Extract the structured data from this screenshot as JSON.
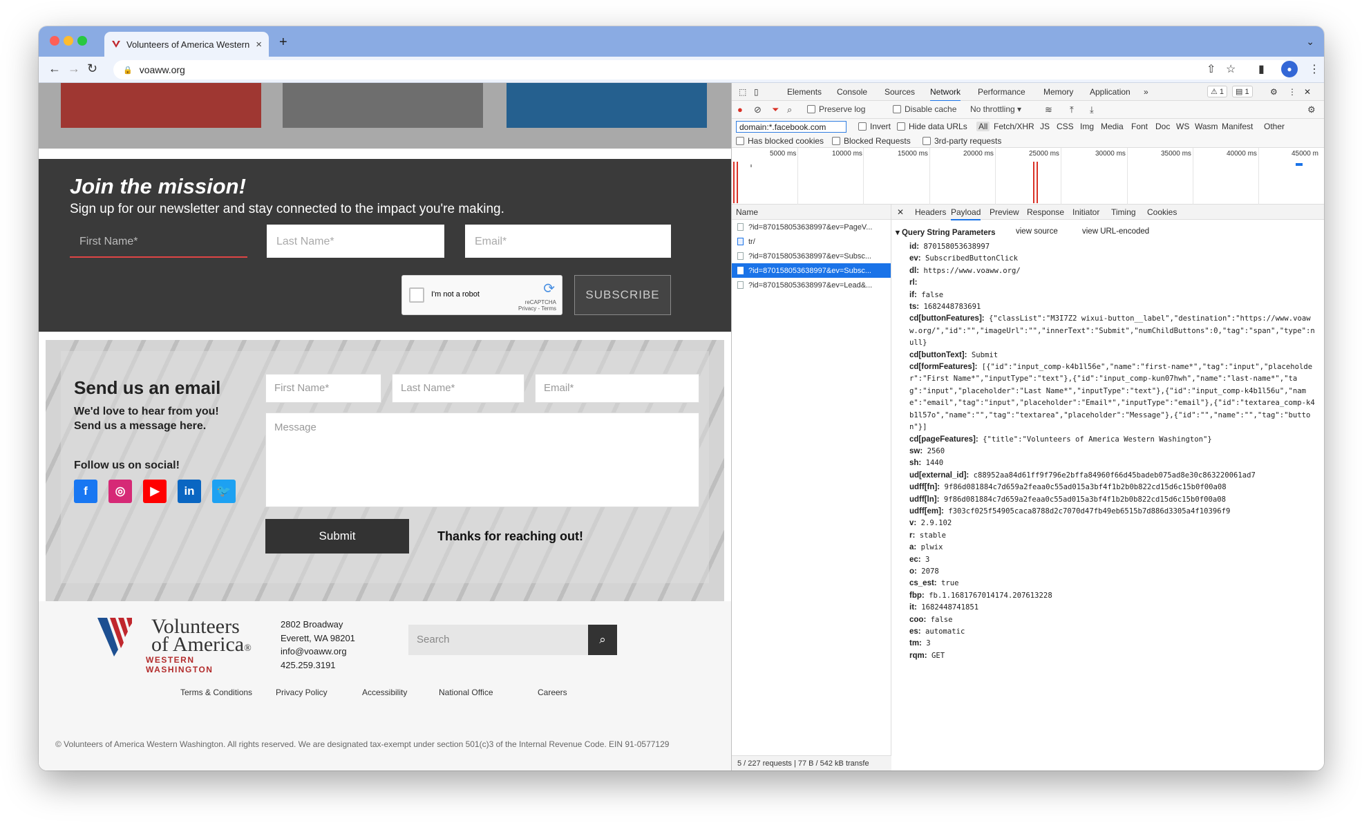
{
  "browser": {
    "tab_title": "Volunteers of America Western Washington",
    "url": "voaww.org"
  },
  "site": {
    "mission": {
      "title": "Join the mission!",
      "subtitle": "Sign up for our newsletter and stay connected to the impact you're making.",
      "first_ph": "First Name*",
      "last_ph": "Last Name*",
      "email_ph": "Email*",
      "captcha": "I'm not a robot",
      "captcha_brand": "reCAPTCHA",
      "captcha_links": "Privacy - Terms",
      "subscribe": "SUBSCRIBE"
    },
    "email": {
      "title": "Send us an email",
      "sub": "We'd love to hear from you!\nSend us a message here.",
      "follow": "Follow us on social!",
      "first_ph": "First Name*",
      "last_ph": "Last Name*",
      "email_ph": "Email*",
      "message_ph": "Message",
      "submit": "Submit",
      "thanks": "Thanks for reaching out!"
    },
    "footer": {
      "logo_top": "Volunteers",
      "logo_mid": "of America",
      "logo_reg": "®",
      "logo_sub": "WESTERN WASHINGTON",
      "addr1": "2802 Broadway",
      "addr2": "Everett, WA 98201",
      "email": "info@voaww.org",
      "phone": "425.259.3191",
      "search_ph": "Search",
      "links": [
        "Terms & Conditions",
        "Privacy Policy",
        "Accessibility",
        "National Office",
        "Careers"
      ],
      "copyright": "© Volunteers of America Western Washington. All rights reserved. We are designated tax-exempt under section 501(c)3 of the Internal Revenue Code. EIN 91-0577129"
    }
  },
  "devtools": {
    "tabs": [
      "Elements",
      "Console",
      "Sources",
      "Network",
      "Performance",
      "Memory",
      "Application"
    ],
    "warn_count": "1",
    "msg_count": "1",
    "preserve_log": "Preserve log",
    "disable_cache": "Disable cache",
    "throttling": "No throttling",
    "filter_value": "domain:*.facebook.com",
    "invert": "Invert",
    "hide_data": "Hide data URLs",
    "types": [
      "All",
      "Fetch/XHR",
      "JS",
      "CSS",
      "Img",
      "Media",
      "Font",
      "Doc",
      "WS",
      "Wasm",
      "Manifest",
      "Other"
    ],
    "blocked_cookies": "Has blocked cookies",
    "blocked_requests": "Blocked Requests",
    "third_party": "3rd-party requests",
    "timeline": [
      "5000 ms",
      "10000 ms",
      "15000 ms",
      "20000 ms",
      "25000 ms",
      "30000 ms",
      "35000 ms",
      "40000 ms",
      "45000 m"
    ],
    "name_header": "Name",
    "requests": [
      "?id=870158053638997&ev=PageV...",
      "tr/",
      "?id=870158053638997&ev=Subsc...",
      "?id=870158053638997&ev=Subsc...",
      "?id=870158053638997&ev=Lead&..."
    ],
    "status": "5 / 227 requests  |  77 B / 542 kB transfe",
    "detail_tabs": [
      "Headers",
      "Payload",
      "Preview",
      "Response",
      "Initiator",
      "Timing",
      "Cookies"
    ],
    "qsp": "Query String Parameters",
    "view_source": "view source",
    "view_url": "view URL-encoded",
    "params": [
      [
        "id:",
        "870158053638997"
      ],
      [
        "ev:",
        "SubscribedButtonClick"
      ],
      [
        "dl:",
        "https://www.voaww.org/"
      ],
      [
        "rl:",
        ""
      ],
      [
        "if:",
        "false"
      ],
      [
        "ts:",
        "1682448783691"
      ],
      [
        "cd[buttonFeatures]:",
        "{\"classList\":\"M3I7Z2 wixui-button__label\",\"destination\":\"https://www.voaww.org/\",\"id\":\"\",\"imageUrl\":\"\",\"innerText\":\"Submit\",\"numChildButtons\":0,\"tag\":\"span\",\"type\":null}"
      ],
      [
        "cd[buttonText]:",
        "Submit"
      ],
      [
        "cd[formFeatures]:",
        "[{\"id\":\"input_comp-k4b1l56e\",\"name\":\"first-name*\",\"tag\":\"input\",\"placeholder\":\"First Name*\",\"inputType\":\"text\"},{\"id\":\"input_comp-kun07hwh\",\"name\":\"last-name*\",\"tag\":\"input\",\"placeholder\":\"Last Name*\",\"inputType\":\"text\"},{\"id\":\"input_comp-k4b1l56u\",\"name\":\"email\",\"tag\":\"input\",\"placeholder\":\"Email*\",\"inputType\":\"email\"},{\"id\":\"textarea_comp-k4b1l57o\",\"name\":\"\",\"tag\":\"textarea\",\"placeholder\":\"Message\"},{\"id\":\"\",\"name\":\"\",\"tag\":\"button\"}]"
      ],
      [
        "cd[pageFeatures]:",
        "{\"title\":\"Volunteers of America Western Washington\"}"
      ],
      [
        "sw:",
        "2560"
      ],
      [
        "sh:",
        "1440"
      ],
      [
        "ud[external_id]:",
        "c88952aa84d61ff9f796e2bffa84960f66d45badeb075ad8e30c863220061ad7"
      ],
      [
        "udff[fn]:",
        "9f86d081884c7d659a2feaa0c55ad015a3bf4f1b2b0b822cd15d6c15b0f00a08"
      ],
      [
        "udff[ln]:",
        "9f86d081884c7d659a2feaa0c55ad015a3bf4f1b2b0b822cd15d6c15b0f00a08"
      ],
      [
        "udff[em]:",
        "f303cf025f54905caca8788d2c7070d47fb49eb6515b7d886d3305a4f10396f9"
      ],
      [
        "v:",
        "2.9.102"
      ],
      [
        "r:",
        "stable"
      ],
      [
        "a:",
        "plwix"
      ],
      [
        "ec:",
        "3"
      ],
      [
        "o:",
        "2078"
      ],
      [
        "cs_est:",
        "true"
      ],
      [
        "fbp:",
        "fb.1.1681767014174.207613228"
      ],
      [
        "it:",
        "1682448741851"
      ],
      [
        "coo:",
        "false"
      ],
      [
        "es:",
        "automatic"
      ],
      [
        "tm:",
        "3"
      ],
      [
        "rqm:",
        "GET"
      ]
    ]
  }
}
